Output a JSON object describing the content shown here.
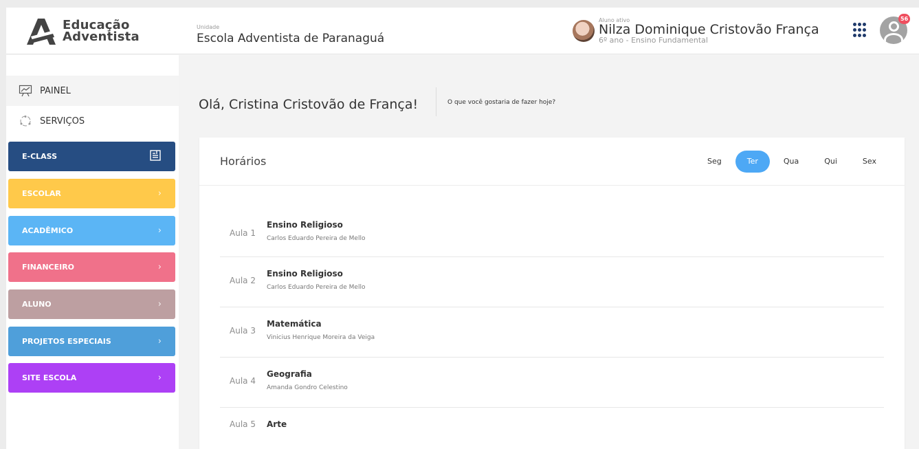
{
  "brand": {
    "name_line1": "Educação",
    "name_line2": "Adventista"
  },
  "unit": {
    "label": "Unidade",
    "name": "Escola Adventista de Paranaguá"
  },
  "active_student": {
    "label": "Aluno ativo",
    "name": "Nilza Dominique Cristovão França",
    "grade": "6º ano - Ensino Fundamental"
  },
  "notifications": {
    "count": "56"
  },
  "sidebar": {
    "nav": [
      {
        "label": "PAINEL",
        "icon": "chart-board-icon"
      },
      {
        "label": "SERVIÇOS",
        "icon": "services-icon"
      }
    ],
    "buttons": [
      {
        "label": "E-CLASS",
        "color": "#264d82",
        "icon": "eclass-icon"
      },
      {
        "label": "ESCOLAR",
        "color": "#ffc94a",
        "icon": "chevron-right-icon"
      },
      {
        "label": "ACADÊMICO",
        "color": "#5bb5f5",
        "icon": "chevron-right-icon"
      },
      {
        "label": "FINANCEIRO",
        "color": "#f0718a",
        "icon": "chevron-right-icon"
      },
      {
        "label": "ALUNO",
        "color": "#bd9fa1",
        "icon": "chevron-right-icon"
      },
      {
        "label": "PROJETOS ESPECIAIS",
        "color": "#4f9fda",
        "icon": "chevron-right-icon"
      },
      {
        "label": "SITE ESCOLA",
        "color": "#ad40f5",
        "icon": "chevron-right-icon"
      }
    ]
  },
  "greeting": {
    "title": "Olá, Cristina Cristovão de França!",
    "subtitle": "O que você gostaria de fazer hoje?"
  },
  "schedule": {
    "title": "Horários",
    "days": [
      "Seg",
      "Ter",
      "Qua",
      "Qui",
      "Sex"
    ],
    "active_day": "Ter",
    "lessons": [
      {
        "label": "Aula 1",
        "subject": "Ensino Religioso",
        "teacher": "Carlos Eduardo Pereira de Mello"
      },
      {
        "label": "Aula 2",
        "subject": "Ensino Religioso",
        "teacher": "Carlos Eduardo Pereira de Mello"
      },
      {
        "label": "Aula 3",
        "subject": "Matemática",
        "teacher": "Vinicius Henrique Moreira da Veiga"
      },
      {
        "label": "Aula 4",
        "subject": "Geografia",
        "teacher": "Amanda Gondro Celestino"
      },
      {
        "label": "Aula 5",
        "subject": "Arte",
        "teacher": ""
      }
    ]
  }
}
